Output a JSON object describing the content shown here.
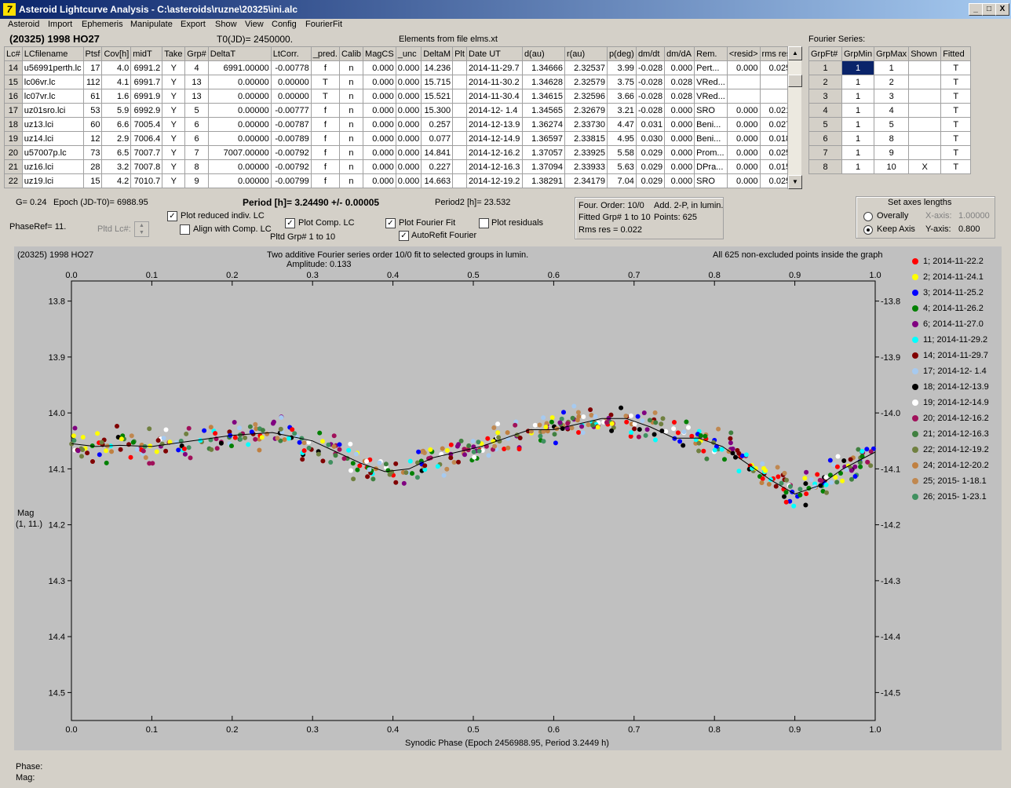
{
  "window": {
    "title": "Asteroid Lightcurve Analysis - C:\\asteroids\\ruzne\\20325\\ini.alc",
    "icon_letter": "7",
    "min": "_",
    "max": "□",
    "close": "X"
  },
  "menu": [
    "Asteroid",
    "Import",
    "Ephemeris",
    "Manipulate",
    "Export",
    "Show",
    "View",
    "Config",
    "FourierFit"
  ],
  "header": {
    "asteroid": "(20325) 1998 HO27",
    "t0": "T0(JD)= 2450000.",
    "elements": "Elements from file elms.xt",
    "fourier_series": "Fourier Series:"
  },
  "table": {
    "columns": [
      "Lc#",
      "LCfilename",
      "Ptsf",
      "Cov[h]",
      "midT",
      "Take",
      "Grp#",
      "DeltaT",
      "LtCorr.",
      "_pred.",
      "Calib",
      "MagCS",
      "_unc",
      "DeltaM",
      "Plt",
      "Date UT",
      "d(au)",
      "r(au)",
      "p(deg)",
      "dm/dt",
      "dm/dA",
      "Rem.",
      "<resid>",
      "rms res"
    ],
    "rows": [
      [
        "14",
        "u56991perth.lc",
        "17",
        "4.0",
        "6991.2",
        "Y",
        "4",
        "6991.00000",
        "-0.00778",
        "f",
        "n",
        "0.000",
        "0.000",
        "14.236",
        "",
        "2014-11-29.7",
        "1.34666",
        "2.32537",
        "3.99",
        "-0.028",
        "0.000",
        "Pert...",
        "0.000",
        "0.025"
      ],
      [
        "15",
        "lc06vr.lc",
        "112",
        "4.1",
        "6991.7",
        "Y",
        "13",
        "0.00000",
        "0.00000",
        "T",
        "n",
        "0.000",
        "0.000",
        "15.715",
        "",
        "2014-11-30.2",
        "1.34628",
        "2.32579",
        "3.75",
        "-0.028",
        "0.028",
        "VRed...",
        "",
        ""
      ],
      [
        "16",
        "lc07vr.lc",
        "61",
        "1.6",
        "6991.9",
        "Y",
        "13",
        "0.00000",
        "0.00000",
        "T",
        "n",
        "0.000",
        "0.000",
        "15.521",
        "",
        "2014-11-30.4",
        "1.34615",
        "2.32596",
        "3.66",
        "-0.028",
        "0.028",
        "VRed...",
        "",
        ""
      ],
      [
        "17",
        "uz01sro.lci",
        "53",
        "5.9",
        "6992.9",
        "Y",
        "5",
        "0.00000",
        "-0.00777",
        "f",
        "n",
        "0.000",
        "0.000",
        "15.300",
        "",
        "2014-12- 1.4",
        "1.34565",
        "2.32679",
        "3.21",
        "-0.028",
        "0.000",
        "SRO",
        "0.000",
        "0.021"
      ],
      [
        "18",
        "uz13.lci",
        "60",
        "6.6",
        "7005.4",
        "Y",
        "6",
        "0.00000",
        "-0.00787",
        "f",
        "n",
        "0.000",
        "0.000",
        "0.257",
        "",
        "2014-12-13.9",
        "1.36274",
        "2.33730",
        "4.47",
        "0.031",
        "0.000",
        "Beni...",
        "0.000",
        "0.027"
      ],
      [
        "19",
        "uz14.lci",
        "12",
        "2.9",
        "7006.4",
        "Y",
        "6",
        "0.00000",
        "-0.00789",
        "f",
        "n",
        "0.000",
        "0.000",
        "0.077",
        "",
        "2014-12-14.9",
        "1.36597",
        "2.33815",
        "4.95",
        "0.030",
        "0.000",
        "Beni...",
        "0.000",
        "0.018"
      ],
      [
        "20",
        "u57007p.lc",
        "73",
        "6.5",
        "7007.7",
        "Y",
        "7",
        "7007.00000",
        "-0.00792",
        "f",
        "n",
        "0.000",
        "0.000",
        "14.841",
        "",
        "2014-12-16.2",
        "1.37057",
        "2.33925",
        "5.58",
        "0.029",
        "0.000",
        "Prom...",
        "0.000",
        "0.025"
      ],
      [
        "21",
        "uz16.lci",
        "28",
        "3.2",
        "7007.8",
        "Y",
        "8",
        "0.00000",
        "-0.00792",
        "f",
        "n",
        "0.000",
        "0.000",
        "0.227",
        "",
        "2014-12-16.3",
        "1.37094",
        "2.33933",
        "5.63",
        "0.029",
        "0.000",
        "DPra...",
        "0.000",
        "0.015"
      ],
      [
        "22",
        "uz19.lci",
        "15",
        "4.2",
        "7010.7",
        "Y",
        "9",
        "0.00000",
        "-0.00799",
        "f",
        "n",
        "0.000",
        "0.000",
        "14.663",
        "",
        "2014-12-19.2",
        "1.38291",
        "2.34179",
        "7.04",
        "0.029",
        "0.000",
        "SRO",
        "0.000",
        "0.025"
      ]
    ]
  },
  "fourier_table": {
    "columns": [
      "GrpFt#",
      "GrpMin",
      "GrpMax",
      "Shown",
      "Fitted"
    ],
    "rows": [
      [
        "1",
        "1",
        "1",
        "",
        "T"
      ],
      [
        "2",
        "1",
        "2",
        "",
        "T"
      ],
      [
        "3",
        "1",
        "3",
        "",
        "T"
      ],
      [
        "4",
        "1",
        "4",
        "",
        "T"
      ],
      [
        "5",
        "1",
        "5",
        "",
        "T"
      ],
      [
        "6",
        "1",
        "8",
        "",
        "T"
      ],
      [
        "7",
        "1",
        "9",
        "",
        "T"
      ],
      [
        "8",
        "1",
        "10",
        "X",
        "T"
      ]
    ]
  },
  "controls": {
    "g": "G= 0.24",
    "epoch": "Epoch (JD-T0)= 6988.95",
    "period": "Period [h]= 3.24490 +/- 0.00005",
    "period2": "Period2 [h]= 23.532",
    "phaseref": "PhaseRef= 11.",
    "pltd_lc": "Pltd Lc#:",
    "plot_reduced": "Plot reduced indiv. LC",
    "align_comp": "Align with Comp. LC",
    "plot_comp": "Plot Comp. LC",
    "pltd_grp": "Pltd Grp#  1   to   10",
    "plot_fourier": "Plot Fourier Fit",
    "autorefit": "AutoRefit Fourier",
    "plot_residuals": "Plot residuals",
    "info1": "Four. Order: 10/0",
    "info2": "Add. 2-P, in lumin.",
    "info3": "Fitted Grp# 1 to 10",
    "info4": "Points: 625",
    "info5": "Rms res      = 0.022",
    "axes_title": "Set axes lengths",
    "overally": "Overally",
    "keep_axis": "Keep Axis",
    "xaxis_label": "X-axis:",
    "xaxis_val": "1.00000",
    "yaxis_label": "Y-axis:",
    "yaxis_val": "0.800"
  },
  "plot": {
    "title_left": "(20325) 1998 HO27",
    "title_center": "Two additive Fourier series order 10/0 fit to selected groups in lumin.",
    "amplitude": "Amplitude: 0.133",
    "title_right": "All 625 non-excluded points inside the graph",
    "ylabel_1": "Mag",
    "ylabel_2": "(1, 11.)",
    "xlabel": "Synodic Phase (Epoch 2456988.95, Period 3.2449 h)",
    "phase_label": "Phase:",
    "mag_label": "Mag:"
  },
  "chart_data": {
    "type": "scatter",
    "x_ticks": [
      "0.0",
      "0.1",
      "0.2",
      "0.3",
      "0.4",
      "0.5",
      "0.6",
      "0.7",
      "0.8",
      "0.9",
      "1.0"
    ],
    "y_ticks": [
      "13.8",
      "13.9",
      "14.0",
      "14.1",
      "14.2",
      "14.3",
      "14.4",
      "14.5"
    ],
    "xlim": [
      0,
      1
    ],
    "ylim": [
      14.55,
      13.75
    ],
    "fit_curve": {
      "x": [
        0,
        0.03,
        0.06,
        0.1,
        0.15,
        0.2,
        0.25,
        0.3,
        0.33,
        0.36,
        0.39,
        0.42,
        0.45,
        0.48,
        0.51,
        0.54,
        0.57,
        0.6,
        0.63,
        0.66,
        0.69,
        0.72,
        0.75,
        0.78,
        0.81,
        0.84,
        0.87,
        0.9,
        0.93,
        0.96,
        1.0
      ],
      "y": [
        14.055,
        14.06,
        14.058,
        14.06,
        14.05,
        14.04,
        14.035,
        14.05,
        14.07,
        14.09,
        14.105,
        14.1,
        14.08,
        14.07,
        14.06,
        14.045,
        14.03,
        14.03,
        14.02,
        14.01,
        14.01,
        14.025,
        14.045,
        14.045,
        14.06,
        14.09,
        14.12,
        14.145,
        14.13,
        14.1,
        14.07
      ]
    },
    "series": [
      {
        "name": "1; 2014-11-22.2",
        "color": "#ff0000"
      },
      {
        "name": "2; 2014-11-24.1",
        "color": "#ffff00"
      },
      {
        "name": "3; 2014-11-25.2",
        "color": "#0000ff"
      },
      {
        "name": "4; 2014-11-26.2",
        "color": "#008000"
      },
      {
        "name": "6; 2014-11-27.0",
        "color": "#800080"
      },
      {
        "name": "11; 2014-11-29.2",
        "color": "#00ffff"
      },
      {
        "name": "14; 2014-11-29.7",
        "color": "#800000"
      },
      {
        "name": "17; 2014-12- 1.4",
        "color": "#a6caf0"
      },
      {
        "name": "18; 2014-12-13.9",
        "color": "#000000"
      },
      {
        "name": "19; 2014-12-14.9",
        "color": "#ffffff"
      },
      {
        "name": "20; 2014-12-16.2",
        "color": "#a0105a"
      },
      {
        "name": "21; 2014-12-16.3",
        "color": "#408040"
      },
      {
        "name": "22; 2014-12-19.2",
        "color": "#708040"
      },
      {
        "name": "24; 2014-12-20.2",
        "color": "#c08040"
      },
      {
        "name": "25; 2015- 1-18.1",
        "color": "#c08850"
      },
      {
        "name": "26; 2015- 1-23.1",
        "color": "#409060"
      }
    ]
  }
}
